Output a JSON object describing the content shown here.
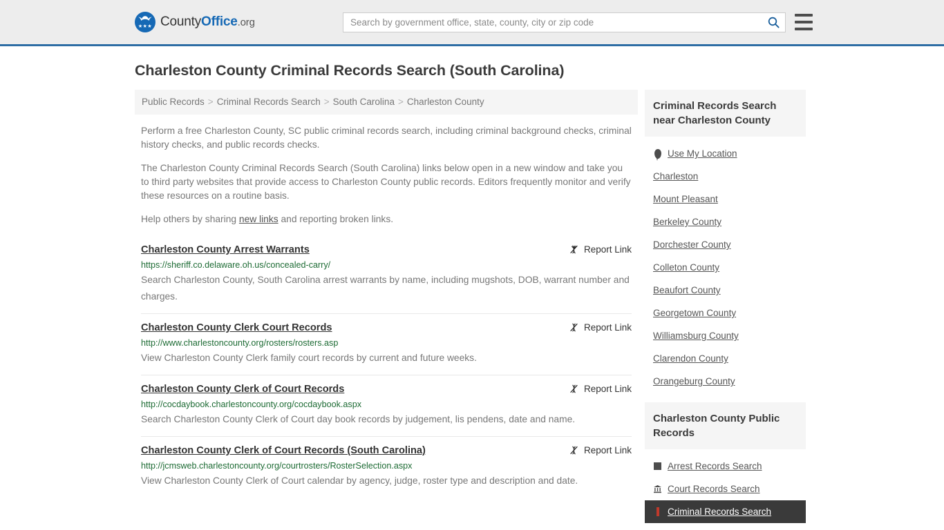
{
  "header": {
    "logo": {
      "prefix": "County",
      "bold": "Office",
      "suffix": ".org",
      "stars": "★★★",
      "icon_name": "eagle-crest-icon"
    },
    "search": {
      "placeholder": "Search by government office, state, county, city or zip code",
      "value": "",
      "search_icon": "search-icon"
    },
    "menu_icon": "hamburger-menu-icon"
  },
  "page": {
    "title": "Charleston County Criminal Records Search (South Carolina)"
  },
  "breadcrumb": {
    "separator": ">",
    "items": [
      "Public Records",
      "Criminal Records Search",
      "South Carolina",
      "Charleston County"
    ]
  },
  "intro": {
    "paragraph1": "Perform a free Charleston County, SC public criminal records search, including criminal background checks, criminal history checks, and public records checks.",
    "paragraph2": "The Charleston County Criminal Records Search (South Carolina) links below open in a new window and take you to third party websites that provide access to Charleston County public records. Editors frequently monitor and verify these resources on a routine basis.",
    "paragraph3_pre": "Help others by sharing ",
    "paragraph3_link": "new links",
    "paragraph3_post": " and reporting broken links."
  },
  "report_link": {
    "label": "Report Link",
    "icon": "broken-link-icon"
  },
  "results": [
    {
      "title": "Charleston County Arrest Warrants",
      "url": "https://sheriff.co.delaware.oh.us/concealed-carry/",
      "description": "Search Charleston County, South Carolina arrest warrants by name, including mugshots, DOB, warrant number and charges."
    },
    {
      "title": "Charleston County Clerk Court Records",
      "url": "http://www.charlestoncounty.org/rosters/rosters.asp",
      "description": "View Charleston County Clerk family court records by current and future weeks."
    },
    {
      "title": "Charleston County Clerk of Court Records",
      "url": "http://cocdaybook.charlestoncounty.org/cocdaybook.aspx",
      "description": "Search Charleston County Clerk of Court day book records by judgement, lis pendens, date and name."
    },
    {
      "title": "Charleston County Clerk of Court Records (South Carolina)",
      "url": "http://jcmsweb.charlestoncounty.org/courtrosters/RosterSelection.aspx",
      "description": "View Charleston County Clerk of Court calendar by agency, judge, roster type and description and date."
    }
  ],
  "sidebar": {
    "nearby": {
      "heading": "Criminal Records Search near Charleston County",
      "items": [
        {
          "label": "Use My Location",
          "icon": "map-pin-icon"
        },
        {
          "label": "Charleston",
          "icon": ""
        },
        {
          "label": "Mount Pleasant",
          "icon": ""
        },
        {
          "label": "Berkeley County",
          "icon": ""
        },
        {
          "label": "Dorchester County",
          "icon": ""
        },
        {
          "label": "Colleton County",
          "icon": ""
        },
        {
          "label": "Beaufort County",
          "icon": ""
        },
        {
          "label": "Georgetown County",
          "icon": ""
        },
        {
          "label": "Williamsburg County",
          "icon": ""
        },
        {
          "label": "Clarendon County",
          "icon": ""
        },
        {
          "label": "Orangeburg County",
          "icon": ""
        }
      ]
    },
    "public_records": {
      "heading": "Charleston County Public Records",
      "items": [
        {
          "label": "Arrest Records Search",
          "icon": "fingerprint-square-icon",
          "active": false
        },
        {
          "label": "Court Records Search",
          "icon": "courthouse-icon",
          "active": false
        },
        {
          "label": "Criminal Records Search",
          "icon": "criminal-record-icon",
          "active": true
        }
      ]
    }
  },
  "colors": {
    "header_bg": "#ededed",
    "header_border": "#2e6da4",
    "brand_blue": "#1669b5",
    "url_green": "#1d6b34",
    "text_gray": "#777777",
    "active_bg": "#3a3a3a"
  }
}
